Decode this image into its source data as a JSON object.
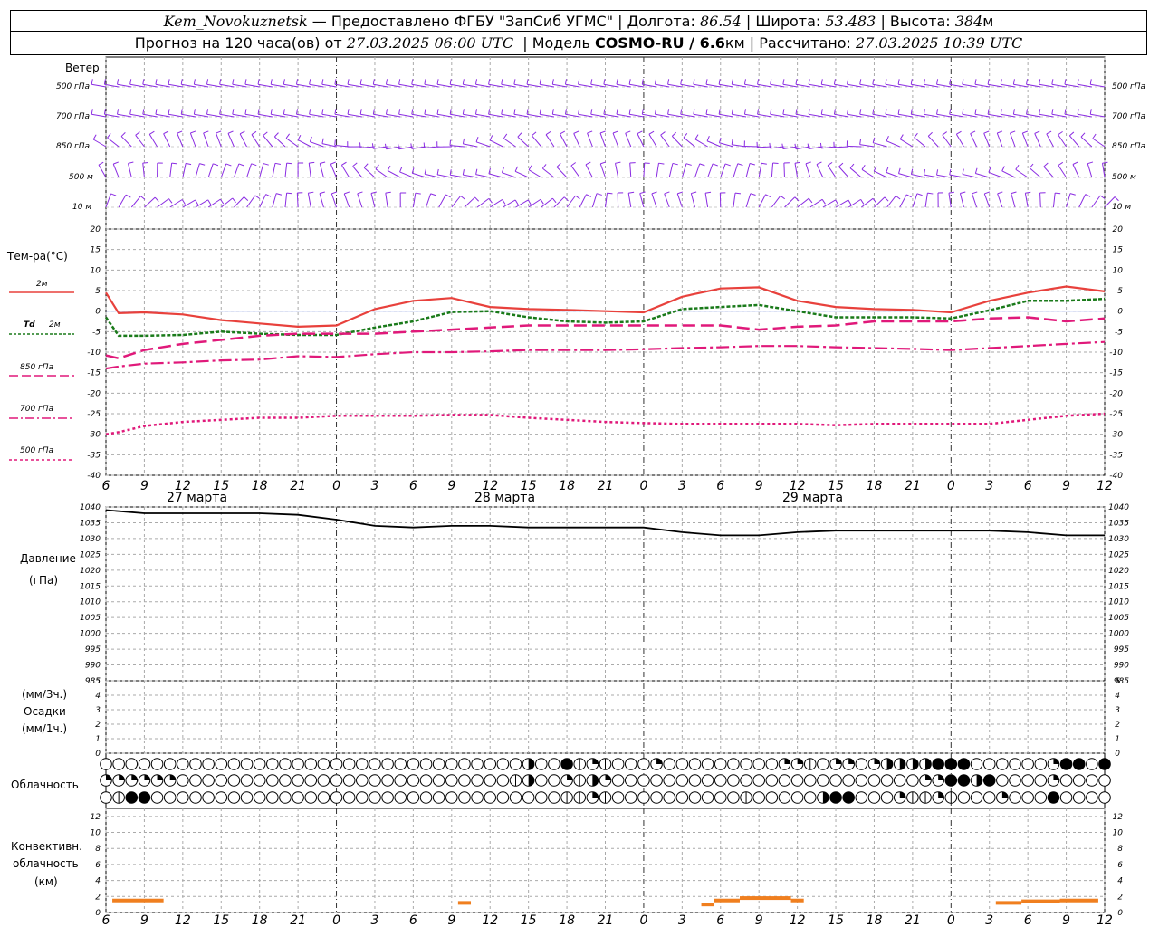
{
  "header": {
    "station": "Kem_Novokuznetsk",
    "provider": " — Предоставлено ФГБУ \"ЗапСиб УГМС\" | Долгота: ",
    "lon": "86.54",
    "lat_label": " | Широта: ",
    "lat": "53.483",
    "alt_label": " | Высота: ",
    "alt": "384",
    "alt_unit": "м",
    "forecast_label": "Прогноз на 120 часа(ов) от ",
    "forecast_from": "27.03.2025 06:00 UTC",
    "model_label": "  | Модель ",
    "model": "COSMO-RU / 6.6",
    "model_unit": "км",
    "calc_label": " | Рассчитано: ",
    "calc_time": "27.03.2025 10:39 UTC"
  },
  "labels": {
    "wind": "Ветер",
    "wind_levels": [
      "500 гПа",
      "700 гПа",
      "850 гПа",
      "500 м",
      "10  м"
    ],
    "temp_title": "Тем-ра(°С)",
    "t2m": "2м",
    "td": "Td",
    "td_2m": "2м",
    "t850": "850 гПа",
    "t700": "700 гПа",
    "t500": "500 гПа",
    "pressure": "Давление",
    "pressure_unit": "(гПа)",
    "precip_unit1": "(мм/3ч.)",
    "precip": "Осадки",
    "precip_unit2": "(мм/1ч.)",
    "cloud": "Облачность",
    "conv1": "Конвективн.",
    "conv2": "облачность",
    "conv3": "(км)",
    "day1": "27 марта",
    "day2": "28 марта",
    "day3": "29 марта"
  },
  "colors": {
    "t2m": "#e8413c",
    "td": "#1a7a1a",
    "t850": "#e0197a",
    "t700": "#e0197a",
    "t500": "#e0197a",
    "wind": "#8a2be2",
    "conv": "#f07f1f",
    "pressure": "#000000",
    "zero_line": "#2a4fd8"
  },
  "chart_data": {
    "type": "line",
    "x_hours_labels": [
      "6",
      "9",
      "12",
      "15",
      "18",
      "21",
      "0",
      "3",
      "6",
      "9",
      "12",
      "15",
      "18",
      "21",
      "0",
      "3",
      "6",
      "9",
      "12",
      "15",
      "18",
      "21",
      "0",
      "3",
      "6",
      "9",
      "12"
    ],
    "x_range_hours": [
      0,
      78
    ],
    "temperature": {
      "ylim": [
        -40,
        20
      ],
      "yticks": [
        20,
        15,
        10,
        5,
        0,
        -5,
        -10,
        -15,
        -20,
        -25,
        -30,
        -35,
        -40
      ],
      "series": [
        {
          "name": "2м",
          "x": [
            0,
            1,
            3,
            6,
            9,
            12,
            15,
            18,
            21,
            24,
            27,
            30,
            33,
            36,
            39,
            42,
            45,
            48,
            51,
            54,
            57,
            60,
            63,
            66,
            69,
            72,
            75,
            78
          ],
          "values": [
            4.5,
            -0.5,
            -0.3,
            -0.8,
            -2.2,
            -3,
            -3.8,
            -3.5,
            0.5,
            2.5,
            3.2,
            1,
            0.5,
            0.3,
            0,
            -0.3,
            3.5,
            5.5,
            5.8,
            2.5,
            1,
            0.5,
            0.3,
            -0.3,
            2.5,
            4.5,
            6,
            4.8
          ]
        },
        {
          "name": "Td 2м",
          "x": [
            0,
            1,
            3,
            6,
            9,
            12,
            15,
            18,
            21,
            24,
            27,
            30,
            33,
            36,
            39,
            42,
            45,
            48,
            51,
            54,
            57,
            60,
            63,
            66,
            69,
            72,
            75,
            78
          ],
          "values": [
            -1.5,
            -6,
            -6,
            -5.8,
            -5,
            -5.5,
            -5.8,
            -5.8,
            -4,
            -2.5,
            -0.2,
            0,
            -1.5,
            -2.5,
            -2.8,
            -2.5,
            0.5,
            1,
            1.5,
            0,
            -1.5,
            -1.5,
            -1.5,
            -1.8,
            0.2,
            2.5,
            2.5,
            3
          ]
        },
        {
          "name": "850 гПа",
          "x": [
            0,
            1,
            3,
            6,
            9,
            12,
            15,
            18,
            21,
            24,
            27,
            30,
            33,
            36,
            39,
            42,
            45,
            48,
            51,
            54,
            57,
            60,
            63,
            66,
            69,
            72,
            75,
            78
          ],
          "values": [
            -10.8,
            -11.5,
            -9.5,
            -8,
            -7,
            -6,
            -5.5,
            -5.5,
            -5.5,
            -5,
            -4.5,
            -4,
            -3.5,
            -3.5,
            -3.5,
            -3.5,
            -3.5,
            -3.5,
            -4.5,
            -3.8,
            -3.5,
            -2.5,
            -2.5,
            -2.5,
            -1.8,
            -1.5,
            -2.5,
            -1.8
          ]
        },
        {
          "name": "700 гПа",
          "x": [
            0,
            1,
            3,
            6,
            9,
            12,
            15,
            18,
            21,
            24,
            27,
            30,
            33,
            36,
            39,
            42,
            45,
            48,
            51,
            54,
            57,
            60,
            63,
            66,
            69,
            72,
            75,
            78
          ],
          "values": [
            -14,
            -13.5,
            -12.8,
            -12.5,
            -12,
            -11.8,
            -11,
            -11.2,
            -10.5,
            -10,
            -10,
            -9.8,
            -9.5,
            -9.5,
            -9.5,
            -9.3,
            -9,
            -8.8,
            -8.5,
            -8.5,
            -8.8,
            -9,
            -9.2,
            -9.5,
            -9,
            -8.5,
            -8,
            -7.5
          ]
        },
        {
          "name": "500 гПа",
          "x": [
            0,
            1,
            3,
            6,
            9,
            12,
            15,
            18,
            21,
            24,
            27,
            30,
            33,
            36,
            39,
            42,
            45,
            48,
            51,
            54,
            57,
            60,
            63,
            66,
            69,
            72,
            75,
            78
          ],
          "values": [
            -30,
            -29.5,
            -28,
            -27,
            -26.5,
            -26,
            -26,
            -25.5,
            -25.5,
            -25.5,
            -25.3,
            -25.3,
            -26,
            -26.5,
            -27,
            -27.3,
            -27.5,
            -27.5,
            -27.5,
            -27.5,
            -27.8,
            -27.5,
            -27.5,
            -27.5,
            -27.5,
            -26.5,
            -25.5,
            -25
          ]
        }
      ]
    },
    "pressure": {
      "ylim": [
        985,
        1040
      ],
      "yticks": [
        1040,
        1035,
        1030,
        1025,
        1020,
        1015,
        1010,
        1005,
        1000,
        995,
        990,
        985
      ],
      "x": [
        0,
        3,
        6,
        9,
        12,
        15,
        18,
        21,
        24,
        27,
        30,
        33,
        36,
        39,
        42,
        45,
        48,
        51,
        54,
        57,
        60,
        63,
        66,
        69,
        72,
        75,
        78
      ],
      "values": [
        1039,
        1038,
        1038,
        1038,
        1038,
        1037.5,
        1036,
        1034,
        1033.5,
        1034,
        1034,
        1033.5,
        1033.5,
        1033.5,
        1033.5,
        1032,
        1031,
        1031,
        1032,
        1032.5,
        1032.5,
        1032.5,
        1032.5,
        1032.5,
        1032,
        1031,
        1031
      ]
    },
    "precipitation": {
      "ylim": [
        0,
        5
      ],
      "yticks": [
        5,
        4,
        3,
        2,
        1,
        0
      ],
      "values": []
    },
    "convective_cloud": {
      "ylim": [
        0,
        13
      ],
      "yticks": [
        12,
        10,
        8,
        6,
        4,
        2,
        0
      ],
      "segments": [
        {
          "x0": 0.5,
          "x1": 4.5,
          "y": 1.5
        },
        {
          "x0": 27.5,
          "x1": 28.5,
          "y": 1.2
        },
        {
          "x0": 46.5,
          "x1": 47.5,
          "y": 1.0
        },
        {
          "x0": 47.5,
          "x1": 49.5,
          "y": 1.5
        },
        {
          "x0": 49.5,
          "x1": 53.5,
          "y": 1.8
        },
        {
          "x0": 53.5,
          "x1": 54.5,
          "y": 1.5
        },
        {
          "x0": 69.5,
          "x1": 71.5,
          "y": 1.2
        },
        {
          "x0": 71.5,
          "x1": 74.5,
          "y": 1.4
        },
        {
          "x0": 74.5,
          "x1": 77.5,
          "y": 1.5
        }
      ]
    }
  }
}
